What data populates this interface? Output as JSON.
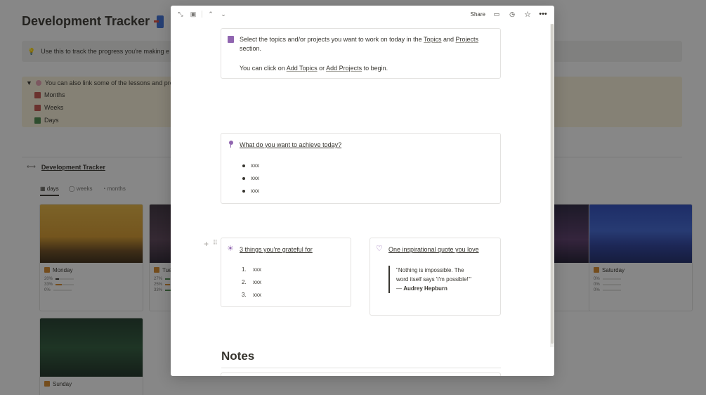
{
  "background": {
    "title": "Development Tracker",
    "callout_text": "Use this to track the progress you're making e",
    "toggle_text": "You can also link some of the lessons and proj",
    "toggle_text_bold": "lessons",
    "links": [
      "Months",
      "Weeks",
      "Days"
    ],
    "link_colors": [
      "#c4554d",
      "#c4554d",
      "#4d8a4d"
    ],
    "database_title": "Development Tracker",
    "tabs": [
      "days",
      "weeks",
      "months"
    ],
    "cards": [
      {
        "name": "Monday",
        "progress": [
          "20%",
          "33%",
          "0%"
        ],
        "fills": [
          0.2,
          0.33,
          0
        ]
      },
      {
        "name": "Tue",
        "progress": [
          "27%",
          "25%",
          "33%"
        ],
        "fills": [
          0.27,
          0.25,
          0.33
        ]
      },
      {
        "name": "Saturday",
        "progress": [
          "0%",
          "0%",
          "0%"
        ],
        "fills": [
          0,
          0,
          0
        ]
      },
      {
        "name": "Sunday",
        "progress": [],
        "fills": []
      }
    ]
  },
  "modal": {
    "share_label": "Share",
    "intro": {
      "line1_pre": "Select the topics and/or projects you want to work on today in the ",
      "topics": "Topics",
      "and": " and ",
      "projects": "Projects",
      "line1_post": "section.",
      "line2_pre": "You can click on ",
      "add_topics": "Add Topics",
      "or": " or ",
      "add_projects": "Add Projects",
      "line2_post": " to begin."
    },
    "achieve": {
      "heading": "What do you want to achieve today?",
      "items": [
        "xxx",
        "xxx",
        "xxx"
      ]
    },
    "grateful": {
      "heading": "3 things you're grateful for",
      "items": [
        "xxx",
        "xxx",
        "xxx"
      ],
      "numbers": [
        "1.",
        "2.",
        "3."
      ]
    },
    "quote": {
      "heading": "One inspirational quote you love",
      "line1": "\"Nothing is impossible. The",
      "line2": "word itself says 'I'm possible!'\"",
      "author_dash": "— ",
      "author": "Audrey Hepburn"
    },
    "notes_heading": "Notes"
  },
  "colors": {
    "text": "#37352f",
    "accent_purple": "#9065b0",
    "callout_bg": "#f1f1ef",
    "toggle_bg": "#fbf3db"
  }
}
